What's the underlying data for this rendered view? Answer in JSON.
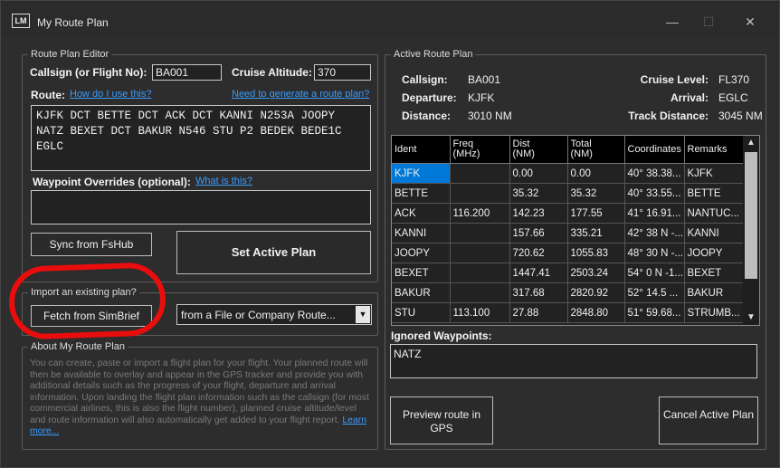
{
  "window": {
    "logo_text": "LM",
    "title": "My Route Plan",
    "minimize_glyph": "—",
    "maximize_glyph": "☐",
    "close_glyph": "✕"
  },
  "editor": {
    "group_label": "Route Plan Editor",
    "callsign_label": "Callsign (or Flight No):",
    "callsign_value": "BA001",
    "altitude_label": "Cruise Altitude:",
    "altitude_value": "370",
    "route_label": "Route:",
    "how_link": "How do I use this?",
    "generate_link": "Need to generate a route plan?",
    "route_text": "KJFK DCT BETTE DCT ACK DCT KANNI N253A JOOPY NATZ BEXET DCT BAKUR N546 STU P2 BEDEK BEDE1C EGLC",
    "overrides_label": "Waypoint Overrides (optional):",
    "overrides_link": "What is this?",
    "overrides_value": "",
    "sync_button": "Sync from FsHub",
    "set_active_button": "Set Active Plan"
  },
  "import": {
    "group_label": "Import an existing plan?",
    "simbrief_button": "Fetch from SimBrief",
    "file_select": "from a File or Company Route..."
  },
  "about": {
    "group_label": "About My Route Plan",
    "text": "You can create, paste or import a flight plan for your flight. Your planned route will then be available to overlay and appear in the GPS tracker and provide you with additional details such as the progress of your flight, departure and arrival information. Upon landing the flight plan information such as the callsign (for most commercial airlines, this is also the flight number), planned cruise altitude/level and route information will also automatically get added to your flight report.",
    "learn_more": "Learn more..."
  },
  "active": {
    "group_label": "Active Route Plan",
    "callsign_label": "Callsign:",
    "callsign_value": "BA001",
    "departure_label": "Departure:",
    "departure_value": "KJFK",
    "distance_label": "Distance:",
    "distance_value": "3010 NM",
    "cruise_label": "Cruise Level:",
    "cruise_value": "FL370",
    "arrival_label": "Arrival:",
    "arrival_value": "EGLC",
    "track_label": "Track Distance:",
    "track_value": "3045 NM",
    "columns": [
      "Ident",
      "Freq\n(MHz)",
      "Dist\n(NM)",
      "Total\n(NM)",
      "Coordinates",
      "Remarks"
    ],
    "rows": [
      [
        "KJFK",
        "",
        "0.00",
        "0.00",
        "40° 38.38...",
        "KJFK"
      ],
      [
        "BETTE",
        "",
        "35.32",
        "35.32",
        "40° 33.55...",
        "BETTE"
      ],
      [
        "ACK",
        "116.200",
        "142.23",
        "177.55",
        "41° 16.91...",
        "NANTUC..."
      ],
      [
        "KANNI",
        "",
        "157.66",
        "335.21",
        "42° 38 N -...",
        "KANNI"
      ],
      [
        "JOOPY",
        "",
        "720.62",
        "1055.83",
        "48° 30 N -...",
        "JOOPY"
      ],
      [
        "BEXET",
        "",
        "1447.41",
        "2503.24",
        "54° 0 N -1...",
        "BEXET"
      ],
      [
        "BAKUR",
        "",
        "317.68",
        "2820.92",
        "52° 14.5 ...",
        "BAKUR"
      ],
      [
        "STU",
        "113.100",
        "27.88",
        "2848.80",
        "51° 59.68...",
        "STRUMB..."
      ]
    ],
    "ignored_label": "Ignored Waypoints:",
    "ignored_value": "NATZ",
    "preview_button": "Preview route in GPS",
    "cancel_button": "Cancel Active Plan"
  },
  "colors": {
    "accent_selection": "#0078d7",
    "link": "#3b9cff",
    "annotation": "#ea0d0d"
  }
}
